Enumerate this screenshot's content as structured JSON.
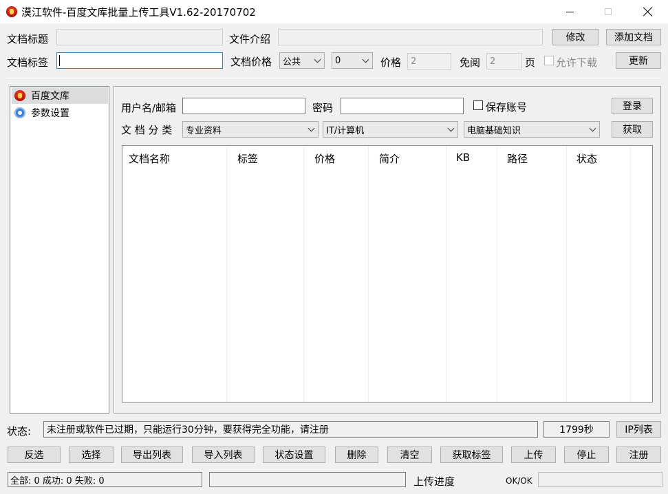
{
  "window": {
    "title": "漠江软件-百度文库批量上传工具V1.62-20170702"
  },
  "top_form": {
    "doc_title_label": "文档标题",
    "doc_title_value": "",
    "file_intro_label": "文件介绍",
    "file_intro_value": "",
    "modify_button": "修改",
    "add_doc_button": "添加文档",
    "doc_tags_label": "文档标签",
    "doc_tags_value": "",
    "doc_price_label": "文档价格",
    "price_type_selected": "公共",
    "price_amount_selected": "0",
    "price_label": "价格",
    "price_value": "2",
    "free_read_label": "免阅",
    "free_read_value": "2",
    "page_unit": "页",
    "allow_download_label": "允许下载",
    "update_button": "更新"
  },
  "sidebar": {
    "items": [
      {
        "label": "百度文库",
        "icon": "baidu-icon",
        "selected": true
      },
      {
        "label": "参数设置",
        "icon": "gear-icon",
        "selected": false
      }
    ]
  },
  "login": {
    "username_label": "用户名/邮箱",
    "username_value": "",
    "password_label": "密码",
    "password_value": "",
    "save_account_label": "保存账号",
    "login_button": "登录",
    "category_label": "文 档 分 类",
    "category1_selected": "专业资料",
    "category2_selected": "IT/计算机",
    "category3_selected": "电脑基础知识",
    "fetch_button": "获取"
  },
  "table": {
    "columns": [
      "文档名称",
      "标签",
      "价格",
      "简介",
      "KB",
      "路径",
      "状态"
    ],
    "rows": []
  },
  "status": {
    "label": "状态:",
    "message": "未注册或软件已过期，只能运行30分钟，要获得完全功能，请注册",
    "timer": "1799秒",
    "ip_list_button": "IP列表"
  },
  "actions": {
    "buttons": [
      "反选",
      "选择",
      "导出列表",
      "导入列表",
      "状态设置",
      "删除",
      "清空",
      "获取标签",
      "上传",
      "停止",
      "注册"
    ]
  },
  "footer": {
    "summary": "全部: 0 成功: 0 失败: 0",
    "progress_label": "上传进度",
    "progress_text": "OK/OK"
  }
}
